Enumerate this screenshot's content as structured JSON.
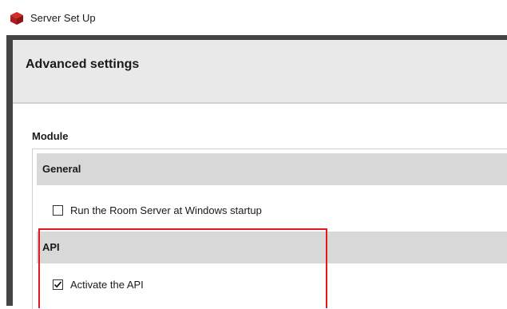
{
  "window": {
    "title": "Server Set Up",
    "icon": "red-cube-icon"
  },
  "header": {
    "title": "Advanced settings"
  },
  "module": {
    "label": "Module",
    "sections": [
      {
        "title": "General",
        "options": [
          {
            "label": "Run the Room Server at Windows startup",
            "checked": false
          }
        ]
      },
      {
        "title": "API",
        "options": [
          {
            "label": "Activate the API",
            "checked": true
          }
        ]
      }
    ]
  },
  "colors": {
    "accent_highlight": "#e11a22",
    "section_header_bg": "#d8d8d8",
    "header_bg": "#e9e9e9",
    "frame": "#444444"
  }
}
